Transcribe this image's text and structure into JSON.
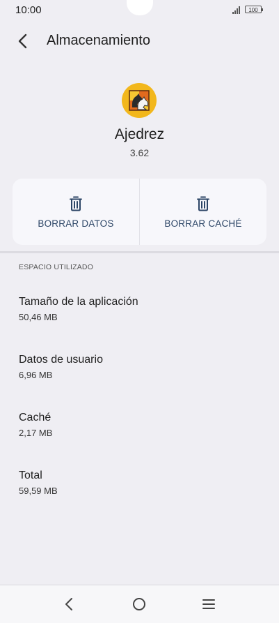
{
  "status_bar": {
    "time": "10:00",
    "battery": "100"
  },
  "header": {
    "title": "Almacenamiento"
  },
  "app": {
    "name": "Ajedrez",
    "version": "3.62"
  },
  "actions": {
    "clear_data": "BORRAR DATOS",
    "clear_cache": "BORRAR CACHÉ"
  },
  "storage": {
    "section_title": "ESPACIO UTILIZADO",
    "items": [
      {
        "label": "Tamaño de la aplicación",
        "value": "50,46 MB"
      },
      {
        "label": "Datos de usuario",
        "value": "6,96 MB"
      },
      {
        "label": "Caché",
        "value": "2,17 MB"
      },
      {
        "label": "Total",
        "value": "59,59 MB"
      }
    ]
  },
  "icons": {
    "back": "chevron-left-icon",
    "trash": "trash-icon",
    "nav_back": "nav-back-icon",
    "nav_home": "home-icon",
    "nav_recents": "menu-icon"
  },
  "colors": {
    "background": "#efeef3",
    "card": "#f7f7fb",
    "accent": "#2c4566"
  }
}
